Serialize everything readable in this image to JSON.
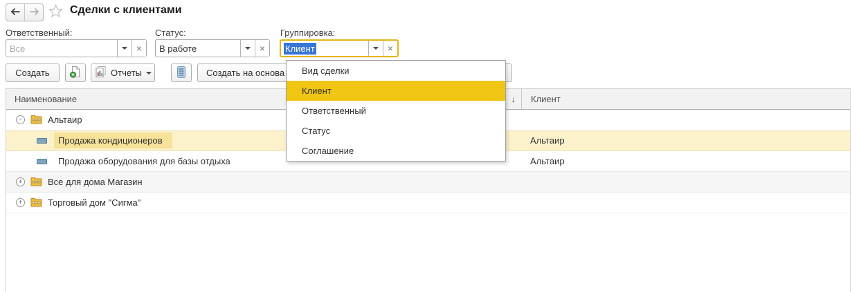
{
  "page": {
    "title": "Сделки с клиентами"
  },
  "icons": {
    "back": "left-arrow-icon",
    "forward": "right-arrow-icon",
    "favorite": "star-outline-icon",
    "dropdown_caret": "▾",
    "clear": "×",
    "sort_descending": "↓",
    "collapse": "−",
    "expand": "+"
  },
  "filters": [
    {
      "label": "Ответственный:",
      "value": "",
      "placeholder": "Все",
      "focused": false
    },
    {
      "label": "Статус:",
      "value": "В работе",
      "placeholder": "",
      "focused": false
    },
    {
      "label": "Группировка:",
      "value": "Клиент",
      "placeholder": "",
      "focused": true,
      "text_selected": true
    }
  ],
  "toolbar": {
    "create": "Создать",
    "reports": "Отчеты",
    "create_based_on": "Создать на основа",
    "icon_names": [
      "new-document-plus-icon",
      "report-chart-icon",
      "related-list-icon"
    ]
  },
  "grouping_dropdown": {
    "items": [
      {
        "label": "Вид сделки",
        "selected": false
      },
      {
        "label": "Клиент",
        "selected": true
      },
      {
        "label": "Ответственный",
        "selected": false
      },
      {
        "label": "Статус",
        "selected": false
      },
      {
        "label": "Соглашение",
        "selected": false
      }
    ]
  },
  "table": {
    "columns": [
      {
        "label": "Наименование",
        "sorted": "desc"
      },
      {
        "label": "Клиент",
        "sorted": null
      }
    ],
    "rows": [
      {
        "type": "group",
        "expanded": true,
        "name": "Альтаир",
        "client": "",
        "selected": false
      },
      {
        "type": "deal",
        "name": "Продажа кондиционеров",
        "client": "Альтаир",
        "selected": true
      },
      {
        "type": "deal",
        "name": "Продажа оборудования для базы отдыха",
        "client": "Альтаир",
        "selected": false
      },
      {
        "type": "group",
        "expanded": false,
        "name": "Все для дома Магазин",
        "client": "",
        "selected": false
      },
      {
        "type": "group",
        "expanded": false,
        "name": "Торговый дом \"Сигма\"",
        "client": "",
        "selected": false
      }
    ]
  },
  "colors": {
    "accent_yellow": "#F0C514",
    "selected_row_bg": "#FBF1CB",
    "selected_cell_bg": "#F6E298",
    "focus_border": "#E4B512",
    "text_selection_bg": "#3875D6"
  }
}
